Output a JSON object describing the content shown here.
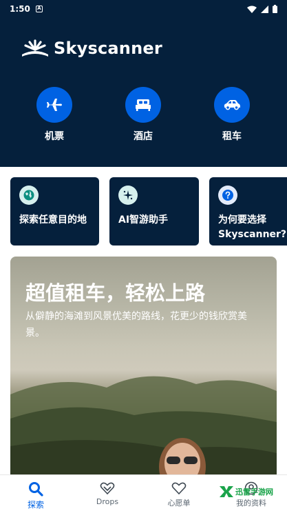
{
  "status_bar": {
    "time": "1:50",
    "notification_glyph": "A"
  },
  "brand": {
    "name": "Skyscanner"
  },
  "services": [
    {
      "label": "机票",
      "icon": "plane-icon"
    },
    {
      "label": "酒店",
      "icon": "bed-icon"
    },
    {
      "label": "租车",
      "icon": "car-icon"
    }
  ],
  "feature_cards": [
    {
      "label": "探索任意目的地",
      "icon": "globe-icon"
    },
    {
      "label": "AI智游助手",
      "icon": "sparkle-icon"
    },
    {
      "label": "为何要选择Skyscanner?",
      "icon": "question-icon"
    }
  ],
  "promo": {
    "title": "超值租车，轻松上路",
    "subtitle": "从僻静的海滩到风景优美的路线，花更少的钱欣赏美景。"
  },
  "tabs": [
    {
      "label": "探索",
      "icon": "search-icon",
      "active": true
    },
    {
      "label": "Drops",
      "icon": "heart-drop-icon",
      "active": false
    },
    {
      "label": "心愿单",
      "icon": "heart-icon",
      "active": false
    },
    {
      "label": "我的资料",
      "icon": "profile-icon",
      "active": false
    }
  ],
  "watermark": {
    "text": "迅雷手游网"
  },
  "colors": {
    "header_bg": "#05203c",
    "accent": "#0062e3",
    "card_icon_bg": "#d6f0ee"
  }
}
